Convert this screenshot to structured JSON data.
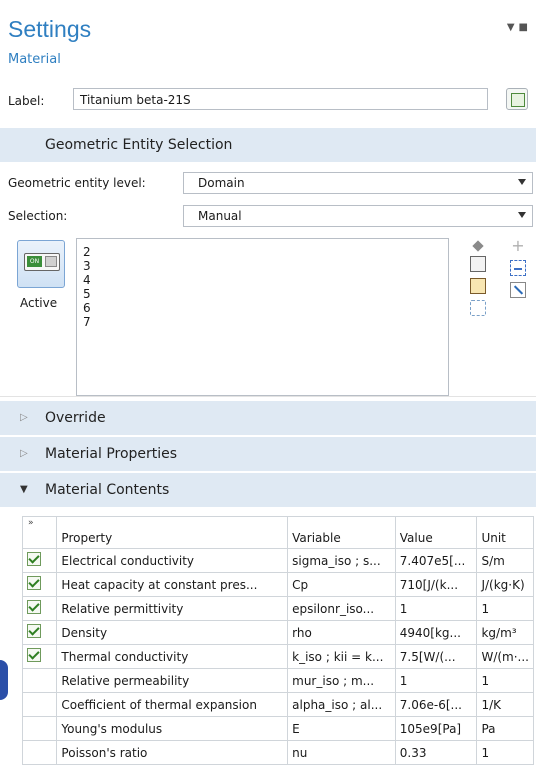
{
  "header": {
    "title": "Settings",
    "subtitle": "Material"
  },
  "label": {
    "text": "Label:",
    "value": "Titanium beta-21S"
  },
  "geom_section": {
    "title": "Geometric Entity Selection"
  },
  "entity_level": {
    "label": "Geometric entity level:",
    "value": "Domain"
  },
  "selection": {
    "label": "Selection:",
    "value": "Manual"
  },
  "active": {
    "state": "ON",
    "label": "Active"
  },
  "selection_list": [
    "2",
    "3",
    "4",
    "5",
    "6",
    "7"
  ],
  "sections": {
    "override": "Override",
    "material_properties": "Material Properties",
    "material_contents": "Material Contents"
  },
  "table": {
    "expand_glyph": "»",
    "headers": [
      "Property",
      "Variable",
      "Value",
      "Unit"
    ],
    "rows": [
      {
        "checked": true,
        "property": "Electrical conductivity",
        "variable": "sigma_iso ; s...",
        "value": "7.407e5[...",
        "unit": "S/m"
      },
      {
        "checked": true,
        "property": "Heat capacity at constant pres...",
        "variable": "Cp",
        "value": "710[J/(k...",
        "unit": "J/(kg·K)"
      },
      {
        "checked": true,
        "property": "Relative permittivity",
        "variable": "epsilonr_iso...",
        "value": "1",
        "unit": "1"
      },
      {
        "checked": true,
        "property": "Density",
        "variable": "rho",
        "value": "4940[kg...",
        "unit": "kg/m³"
      },
      {
        "checked": true,
        "property": "Thermal conductivity",
        "variable": "k_iso ; kii = k...",
        "value": "7.5[W/(...",
        "unit": "W/(m·..."
      },
      {
        "checked": false,
        "property": "Relative permeability",
        "variable": "mur_iso ; m...",
        "value": "1",
        "unit": "1"
      },
      {
        "checked": false,
        "property": "Coefficient of thermal expansion",
        "variable": "alpha_iso ; al...",
        "value": "7.06e-6[...",
        "unit": "1/K"
      },
      {
        "checked": false,
        "property": "Young's modulus",
        "variable": "E",
        "value": "105e9[Pa]",
        "unit": "Pa"
      },
      {
        "checked": false,
        "property": "Poisson's ratio",
        "variable": "nu",
        "value": "0.33",
        "unit": "1"
      }
    ]
  }
}
